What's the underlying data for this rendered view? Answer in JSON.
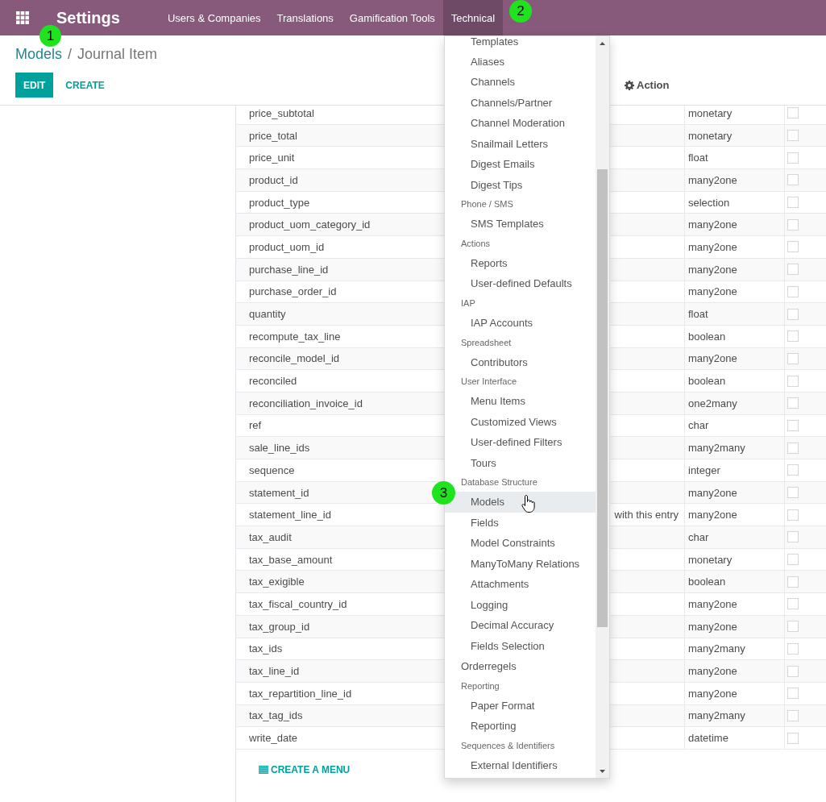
{
  "navbar": {
    "app_title": "Settings",
    "menu": [
      {
        "label": "Users & Companies",
        "selected": false
      },
      {
        "label": "Translations",
        "selected": false
      },
      {
        "label": "Gamification Tools",
        "selected": false
      },
      {
        "label": "Technical",
        "selected": true
      }
    ]
  },
  "breadcrumb": {
    "items": [
      {
        "label": "Models",
        "kind": "link"
      },
      {
        "label": "Journal Item",
        "kind": "current"
      }
    ],
    "separator": "/"
  },
  "buttons": [
    {
      "label": "EDIT",
      "kind": "primary"
    },
    {
      "label": "CREATE",
      "kind": "secondary"
    }
  ],
  "action_menu": {
    "label": "Action"
  },
  "table": {
    "rows": [
      {
        "column_1": "price_subtotal",
        "column_3": "monetary",
        "checked": false
      },
      {
        "column_1": "price_total",
        "column_3": "monetary",
        "checked": false
      },
      {
        "column_1": "price_unit",
        "column_3": "float",
        "checked": false
      },
      {
        "column_1": "product_id",
        "column_3": "many2one",
        "checked": false
      },
      {
        "column_1": "product_type",
        "column_3": "selection",
        "checked": false
      },
      {
        "column_1": "product_uom_category_id",
        "column_3": "many2one",
        "checked": false
      },
      {
        "column_1": "product_uom_id",
        "column_3": "many2one",
        "checked": false
      },
      {
        "column_1": "purchase_line_id",
        "column_3": "many2one",
        "checked": false
      },
      {
        "column_1": "purchase_order_id",
        "column_3": "many2one",
        "checked": false
      },
      {
        "column_1": "quantity",
        "column_3": "float",
        "checked": false
      },
      {
        "column_1": "recompute_tax_line",
        "column_3": "boolean",
        "checked": false
      },
      {
        "column_1": "reconcile_model_id",
        "column_3": "many2one",
        "checked": false
      },
      {
        "column_1": "reconciled",
        "column_3": "boolean",
        "checked": false
      },
      {
        "column_1": "reconciliation_invoice_id",
        "column_3": "one2many",
        "checked": false
      },
      {
        "column_1": "ref",
        "column_3": "char",
        "checked": false
      },
      {
        "column_1": "sale_line_ids",
        "column_3": "many2many",
        "checked": false
      },
      {
        "column_1": "sequence",
        "column_3": "integer",
        "checked": false
      },
      {
        "column_1": "statement_id",
        "column_3": "many2one",
        "checked": false
      },
      {
        "column_1": "statement_line_id",
        "column_2": "with this entry",
        "column_3": "many2one",
        "checked": false
      },
      {
        "column_1": "tax_audit",
        "column_3": "char",
        "checked": false
      },
      {
        "column_1": "tax_base_amount",
        "column_3": "monetary",
        "checked": false
      },
      {
        "column_1": "tax_exigible",
        "column_3": "boolean",
        "checked": false
      },
      {
        "column_1": "tax_fiscal_country_id",
        "column_3": "many2one",
        "checked": false
      },
      {
        "column_1": "tax_group_id",
        "column_3": "many2one",
        "checked": false
      },
      {
        "column_1": "tax_ids",
        "column_3": "many2many",
        "checked": false
      },
      {
        "column_1": "tax_line_id",
        "column_3": "many2one",
        "checked": false
      },
      {
        "column_1": "tax_repartition_line_id",
        "column_3": "many2one",
        "checked": false
      },
      {
        "column_1": "tax_tag_ids",
        "column_3": "many2many",
        "checked": false
      },
      {
        "column_1": "write_date",
        "column_3": "datetime",
        "checked": false
      }
    ]
  },
  "create_menu_link": {
    "label": "CREATE A MENU"
  },
  "dropdown": {
    "entries": [
      {
        "kind": "group",
        "children": [
          {
            "label": "Templates",
            "highlighted": false
          },
          {
            "label": "Aliases",
            "highlighted": false
          },
          {
            "label": "Channels",
            "highlighted": false
          },
          {
            "label": "Channels/Partner",
            "highlighted": false
          },
          {
            "label": "Channel Moderation",
            "highlighted": false
          },
          {
            "label": "Snailmail Letters",
            "highlighted": false
          },
          {
            "label": "Digest Emails",
            "highlighted": false
          },
          {
            "label": "Digest Tips",
            "highlighted": false
          }
        ]
      },
      {
        "kind": "group",
        "label": "Phone / SMS",
        "children": [
          {
            "label": "SMS Templates",
            "highlighted": false
          }
        ]
      },
      {
        "kind": "group",
        "label": "Actions",
        "children": [
          {
            "label": "Reports",
            "highlighted": false
          },
          {
            "label": "User-defined Defaults",
            "highlighted": false
          }
        ]
      },
      {
        "kind": "group",
        "label": "IAP",
        "children": [
          {
            "label": "IAP Accounts",
            "highlighted": false
          }
        ]
      },
      {
        "kind": "group",
        "label": "Spreadsheet",
        "children": [
          {
            "label": "Contributors",
            "highlighted": false
          }
        ]
      },
      {
        "kind": "group",
        "label": "User Interface",
        "children": [
          {
            "label": "Menu Items",
            "highlighted": false
          },
          {
            "label": "Customized Views",
            "highlighted": false
          },
          {
            "label": "User-defined Filters",
            "highlighted": false
          },
          {
            "label": "Tours",
            "highlighted": false
          }
        ]
      },
      {
        "kind": "group",
        "label": "Database Structure",
        "children": [
          {
            "label": "Models",
            "highlighted": true
          },
          {
            "label": "Fields",
            "highlighted": false
          },
          {
            "label": "Model Constraints",
            "highlighted": false
          },
          {
            "label": "ManyToMany Relations",
            "highlighted": false
          },
          {
            "label": "Attachments",
            "highlighted": false
          },
          {
            "label": "Logging",
            "highlighted": false
          },
          {
            "label": "Decimal Accuracy",
            "highlighted": false
          },
          {
            "label": "Fields Selection",
            "highlighted": false
          }
        ]
      },
      {
        "kind": "item",
        "label": "Orderregels",
        "highlighted": false
      },
      {
        "kind": "group",
        "label": "Reporting",
        "children": [
          {
            "label": "Paper Format",
            "highlighted": false
          },
          {
            "label": "Reporting",
            "highlighted": false
          }
        ]
      },
      {
        "kind": "group",
        "label": "Sequences & Identifiers",
        "children": [
          {
            "label": "External Identifiers",
            "highlighted": false
          }
        ]
      }
    ]
  },
  "markers": [
    {
      "label": "1"
    },
    {
      "label": "2"
    },
    {
      "label": "3"
    }
  ]
}
